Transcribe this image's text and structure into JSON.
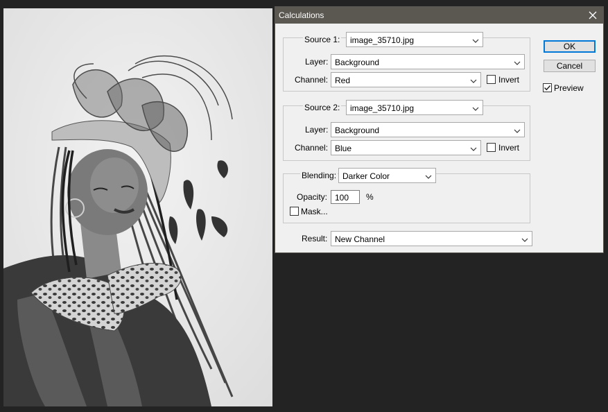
{
  "dialog": {
    "title": "Calculations",
    "close_icon": "close-icon",
    "source1": {
      "label": "Source 1:",
      "value": "image_35710.jpg",
      "layer_label": "Layer:",
      "layer_value": "Background",
      "channel_label": "Channel:",
      "channel_value": "Red",
      "invert_label": "Invert",
      "invert_checked": false
    },
    "source2": {
      "label": "Source 2:",
      "value": "image_35710.jpg",
      "layer_label": "Layer:",
      "layer_value": "Background",
      "channel_label": "Channel:",
      "channel_value": "Blue",
      "invert_label": "Invert",
      "invert_checked": false
    },
    "blending": {
      "label": "Blending:",
      "value": "Darker Color",
      "opacity_label": "Opacity:",
      "opacity_value": "100",
      "opacity_unit": "%",
      "mask_label": "Mask...",
      "mask_checked": false
    },
    "result": {
      "label": "Result:",
      "value": "New Channel"
    },
    "buttons": {
      "ok": "OK",
      "cancel": "Cancel"
    },
    "preview": {
      "label": "Preview",
      "checked": true
    }
  },
  "colors": {
    "app_background": "#232323",
    "titlebar": "#5b5751",
    "dialog_background": "#f0f0f0",
    "default_button_border": "#0078d7"
  },
  "canvas": {
    "content": "grayscale photo"
  }
}
